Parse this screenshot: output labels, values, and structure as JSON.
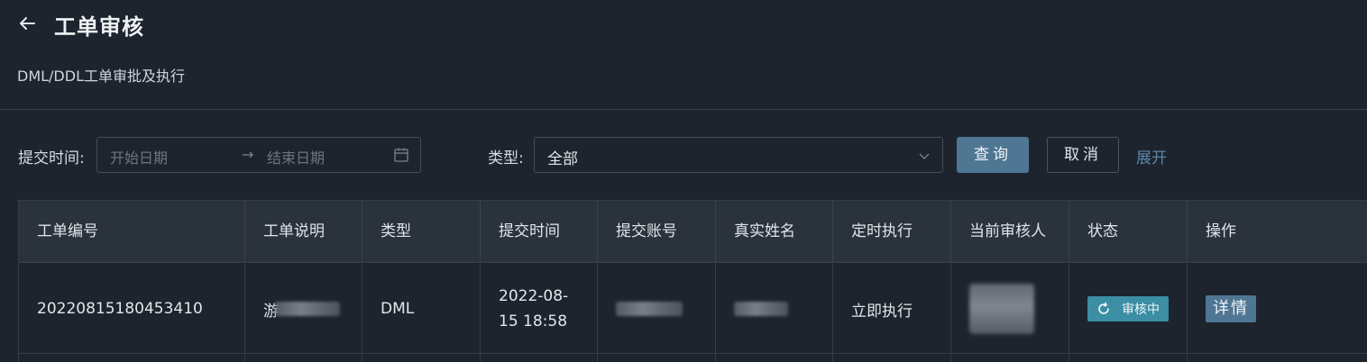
{
  "header": {
    "title": "工单审核",
    "subtitle": "DML/DDL工单审批及执行"
  },
  "filters": {
    "submit_time_label": "提交时间:",
    "start_placeholder": "开始日期",
    "range_arrow": "→",
    "end_placeholder": "结束日期",
    "type_label": "类型:",
    "type_value": "全部",
    "query_button": "查询",
    "cancel_button": "取消",
    "expand_link": "展开"
  },
  "table": {
    "columns": [
      "工单编号",
      "工单说明",
      "类型",
      "提交时间",
      "提交账号",
      "真实姓名",
      "定时执行",
      "当前审核人",
      "状态",
      "操作"
    ],
    "rows": [
      {
        "id": "20220815180453410",
        "description_prefix": "游",
        "type": "DML",
        "submit_time_date": "2022-08-",
        "submit_time_rest": "15 18:58",
        "exec_mode": "立即执行",
        "status": "审核中",
        "action": "详情"
      }
    ]
  },
  "colors": {
    "background": "#1d242d",
    "header_row": "#2a323c",
    "primary": "#4f7693",
    "status_badge": "#3b8ea3",
    "link": "#5b87a8"
  }
}
